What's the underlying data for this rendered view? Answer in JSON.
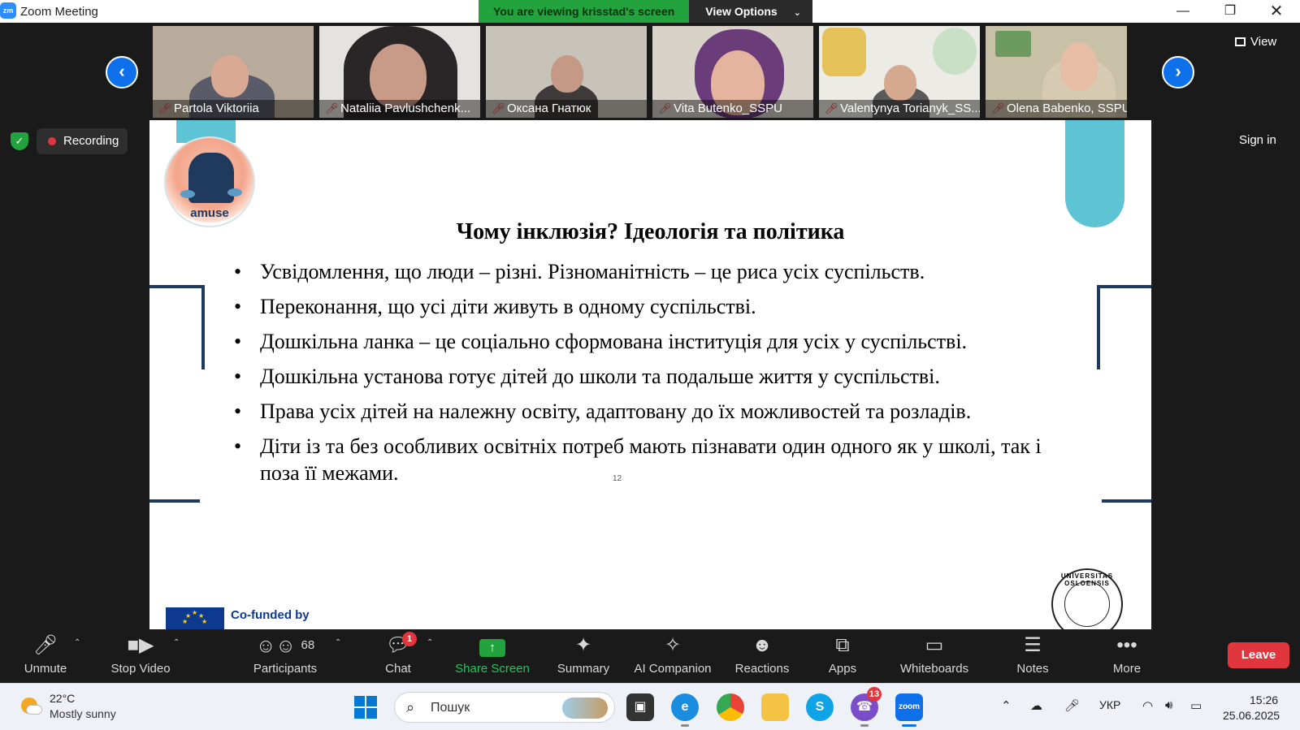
{
  "window": {
    "app_icon": "zm",
    "title": "Zoom Meeting",
    "controls": [
      "minimize-icon",
      "restore-icon",
      "close-icon"
    ]
  },
  "share_banner": {
    "viewing_text": "You are viewing krisstad's screen",
    "view_options_label": "View Options"
  },
  "thumbnails": [
    {
      "name": "Partola Viktoriia"
    },
    {
      "name": "Nataliia Pavlushchenk..."
    },
    {
      "name": "Оксана Гнатюк"
    },
    {
      "name": "Vita Butenko_SSPU"
    },
    {
      "name": "Valentynya Torianyk_SS..."
    },
    {
      "name": "Olena Babenko, SSPU"
    }
  ],
  "header_right": {
    "view_label": "View",
    "sign_in_label": "Sign in"
  },
  "recording": {
    "label": "Recording"
  },
  "slide": {
    "logo_word": "amuse",
    "title": "Чому інклюзія?  Ідеологія та політика",
    "bullets": [
      "Усвідомлення, що люди – різні. Різноманітність – це риса усіх суспільств.",
      "Переконання, що усі діти живуть в одному суспільстві.",
      "Дошкільна ланка – це соціально сформована інституція для усіх у суспільстві.",
      "Дошкільна установа готує дітей до школи та подальше життя у суспільстві.",
      "Права усіх дітей на належну освіту, адаптовану до їх можливостей та розладів.",
      "Діти із та без особливих освітніх потреб мають пізнавати один одного як у школі, так і поза її межами."
    ],
    "page_number": "12",
    "cofunded_label": "Co-funded by",
    "seal_text": "UNIVERSITAS OSLOENSIS"
  },
  "toolbar": {
    "unmute": "Unmute",
    "stop_video": "Stop Video",
    "participants": "Participants",
    "participants_count": "68",
    "chat": "Chat",
    "chat_badge": "1",
    "share_screen": "Share Screen",
    "summary": "Summary",
    "ai_companion": "AI Companion",
    "reactions": "Reactions",
    "apps": "Apps",
    "whiteboards": "Whiteboards",
    "notes": "Notes",
    "more": "More",
    "leave": "Leave"
  },
  "taskbar": {
    "weather_temp": "22°C",
    "weather_desc": "Mostly sunny",
    "search_placeholder": "Пошук",
    "viber_badge": "13",
    "language": "УКР",
    "time": "15:26",
    "date": "25.06.2025"
  },
  "colors": {
    "zoom_blue": "#0e71eb",
    "share_green": "#22a33d",
    "leave_red": "#e0363c",
    "slide_teal": "#5ec3d4",
    "slide_navy": "#1f3a5c"
  }
}
